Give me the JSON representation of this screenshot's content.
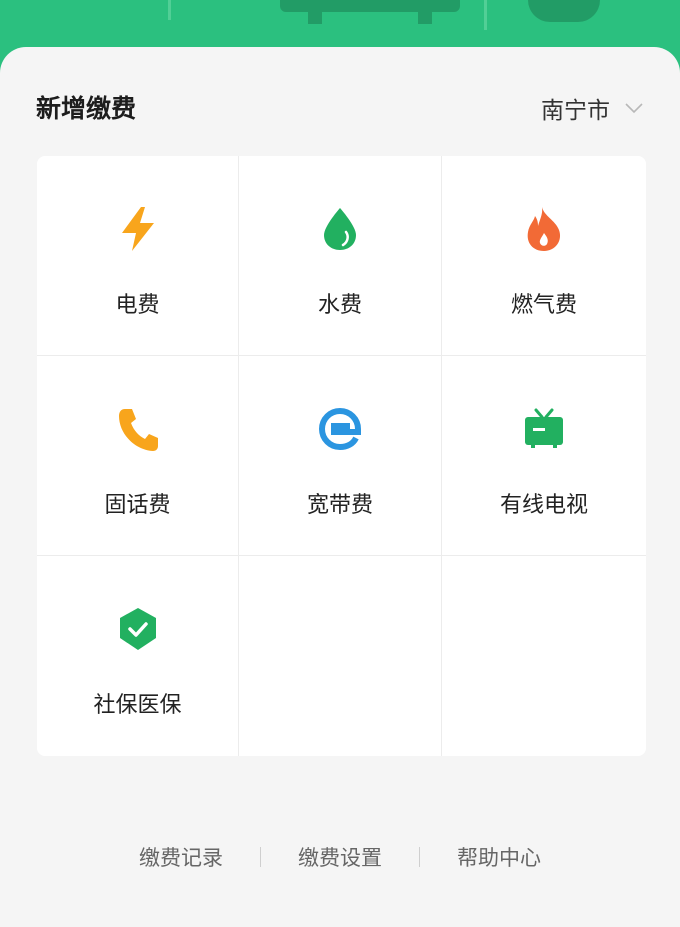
{
  "header": {
    "title": "新增缴费",
    "city": "南宁市"
  },
  "payment_types": [
    {
      "label": "电费",
      "icon": "lightning-icon",
      "color": "#f8a51c"
    },
    {
      "label": "水费",
      "icon": "water-drop-icon",
      "color": "#22b060"
    },
    {
      "label": "燃气费",
      "icon": "flame-icon",
      "color": "#f26a36"
    },
    {
      "label": "固话费",
      "icon": "phone-icon",
      "color": "#f8a51c"
    },
    {
      "label": "宽带费",
      "icon": "browser-e-icon",
      "color": "#2b95e0"
    },
    {
      "label": "有线电视",
      "icon": "tv-icon",
      "color": "#22b060"
    },
    {
      "label": "社保医保",
      "icon": "shield-check-icon",
      "color": "#22b060"
    }
  ],
  "footer": {
    "links": [
      "缴费记录",
      "缴费设置",
      "帮助中心"
    ]
  }
}
